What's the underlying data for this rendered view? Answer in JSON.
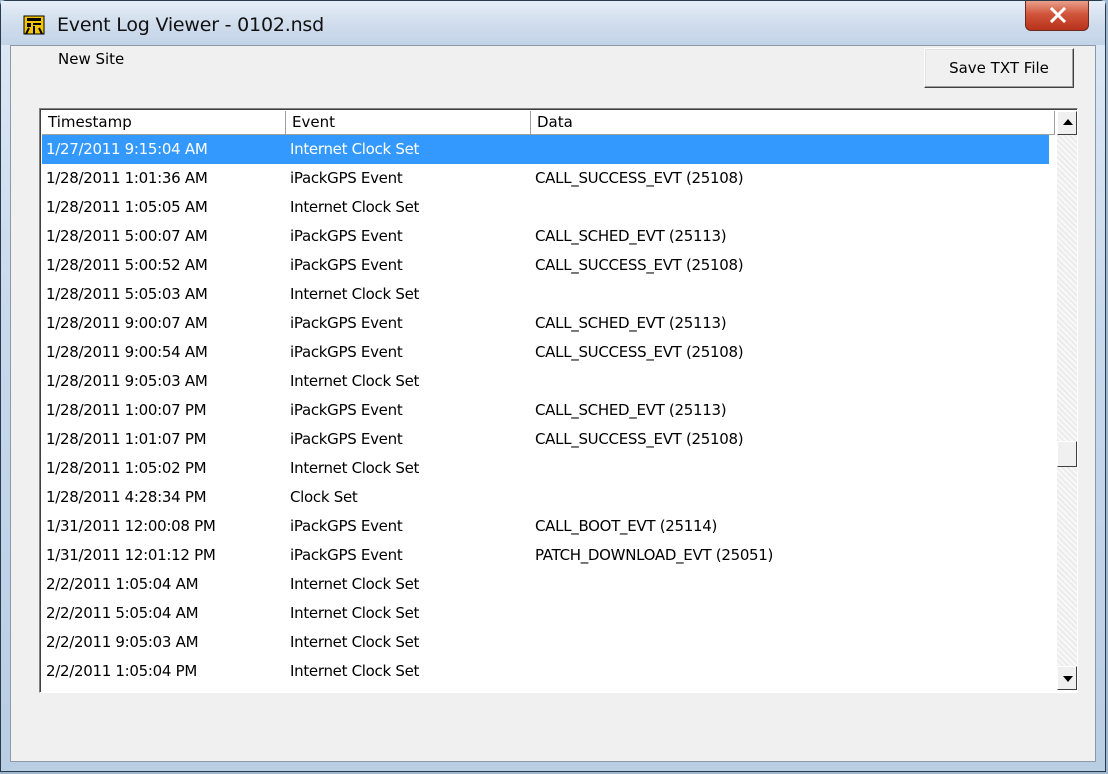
{
  "window": {
    "title": "Event Log Viewer - 0102.nsd",
    "close_symbol": "X"
  },
  "site": {
    "name": "New Site"
  },
  "toolbar": {
    "save_label": "Save TXT File"
  },
  "table": {
    "columns": [
      "Timestamp",
      "Event",
      "Data"
    ],
    "rows": [
      {
        "timestamp": "1/27/2011 9:15:04 AM",
        "event": "Internet Clock Set",
        "data": "",
        "selected": true
      },
      {
        "timestamp": "1/28/2011 1:01:36 AM",
        "event": "iPackGPS Event",
        "data": "CALL_SUCCESS_EVT (25108)"
      },
      {
        "timestamp": "1/28/2011 1:05:05 AM",
        "event": "Internet Clock Set",
        "data": ""
      },
      {
        "timestamp": "1/28/2011 5:00:07 AM",
        "event": "iPackGPS Event",
        "data": "CALL_SCHED_EVT (25113)"
      },
      {
        "timestamp": "1/28/2011 5:00:52 AM",
        "event": "iPackGPS Event",
        "data": "CALL_SUCCESS_EVT (25108)"
      },
      {
        "timestamp": "1/28/2011 5:05:03 AM",
        "event": "Internet Clock Set",
        "data": ""
      },
      {
        "timestamp": "1/28/2011 9:00:07 AM",
        "event": "iPackGPS Event",
        "data": "CALL_SCHED_EVT (25113)"
      },
      {
        "timestamp": "1/28/2011 9:00:54 AM",
        "event": "iPackGPS Event",
        "data": "CALL_SUCCESS_EVT (25108)"
      },
      {
        "timestamp": "1/28/2011 9:05:03 AM",
        "event": "Internet Clock Set",
        "data": ""
      },
      {
        "timestamp": "1/28/2011 1:00:07 PM",
        "event": "iPackGPS Event",
        "data": "CALL_SCHED_EVT (25113)"
      },
      {
        "timestamp": "1/28/2011 1:01:07 PM",
        "event": "iPackGPS Event",
        "data": "CALL_SUCCESS_EVT (25108)"
      },
      {
        "timestamp": "1/28/2011 1:05:02 PM",
        "event": "Internet Clock Set",
        "data": ""
      },
      {
        "timestamp": "1/28/2011 4:28:34 PM",
        "event": "Clock Set",
        "data": ""
      },
      {
        "timestamp": "1/31/2011 12:00:08 PM",
        "event": "iPackGPS Event",
        "data": "CALL_BOOT_EVT (25114)"
      },
      {
        "timestamp": "1/31/2011 12:01:12 PM",
        "event": "iPackGPS Event",
        "data": "PATCH_DOWNLOAD_EVT (25051)"
      },
      {
        "timestamp": "2/2/2011 1:05:04 AM",
        "event": "Internet Clock Set",
        "data": ""
      },
      {
        "timestamp": "2/2/2011 5:05:04 AM",
        "event": "Internet Clock Set",
        "data": ""
      },
      {
        "timestamp": "2/2/2011 9:05:03 AM",
        "event": "Internet Clock Set",
        "data": ""
      },
      {
        "timestamp": "2/2/2011 1:05:04 PM",
        "event": "Internet Clock Set",
        "data": ""
      }
    ]
  },
  "colors": {
    "selection": "#3399ff",
    "close_button": "#c7432b"
  },
  "icons": {
    "app": "event-log-icon",
    "close": "close-icon",
    "scroll_up": "scroll-up-arrow-icon",
    "scroll_down": "scroll-down-arrow-icon"
  }
}
